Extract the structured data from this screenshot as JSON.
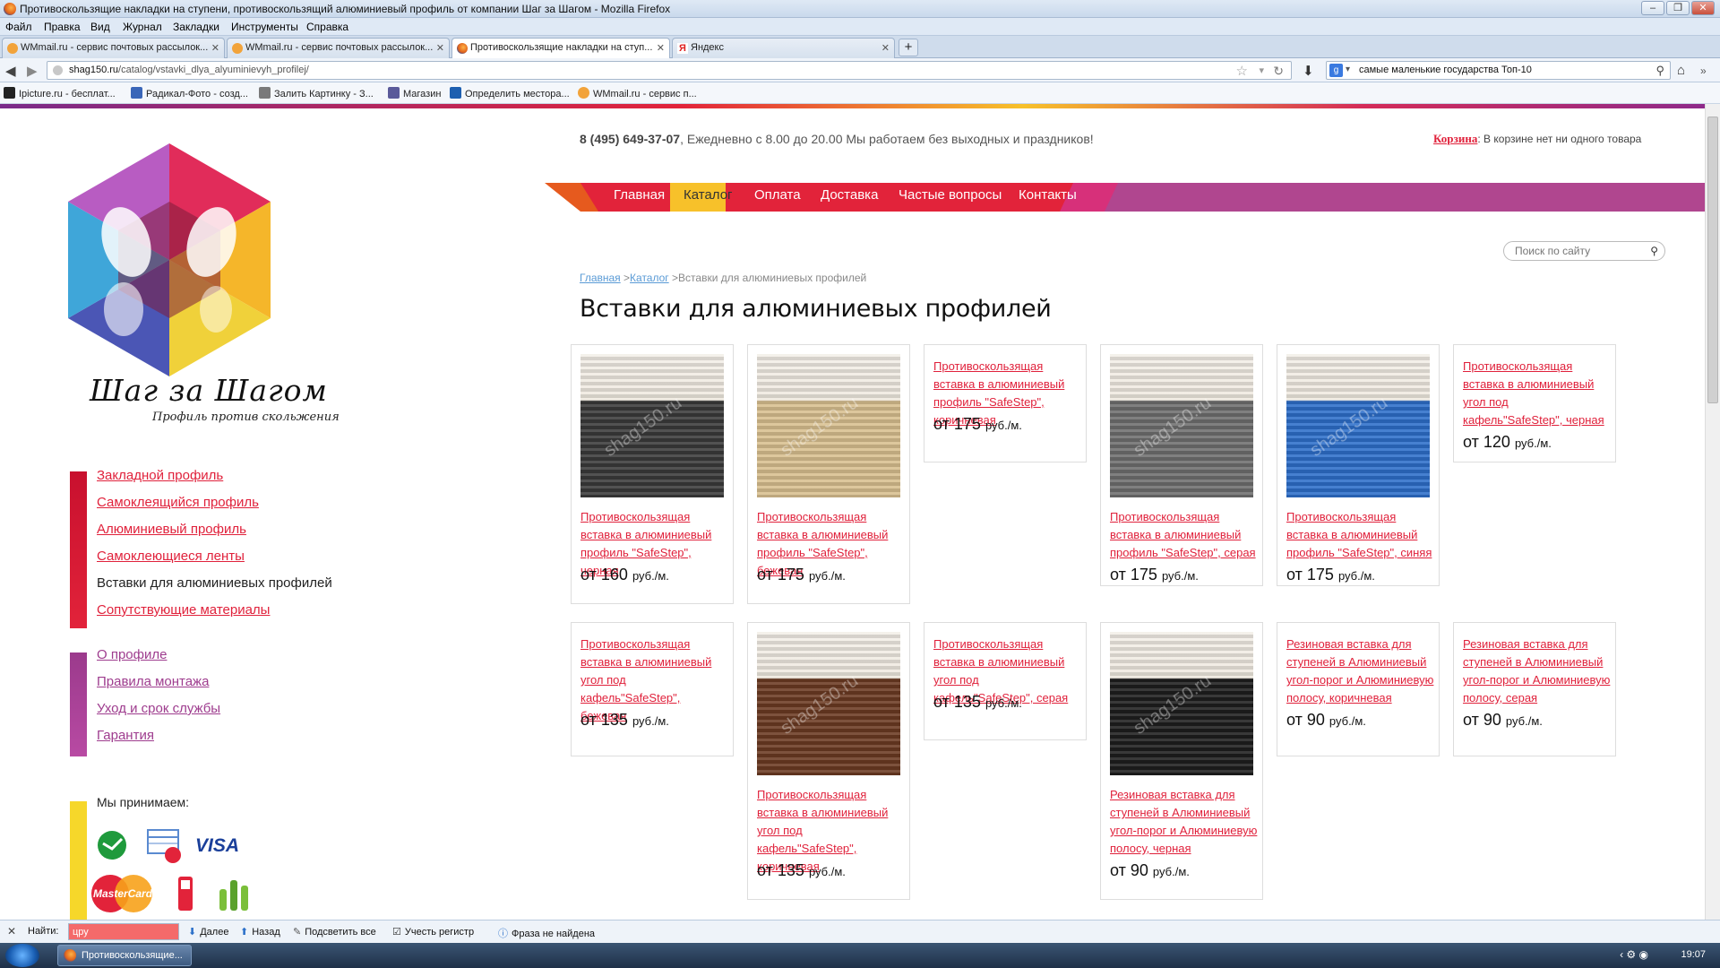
{
  "window": {
    "title": "Противоскользящие накладки на ступени, противоскользящий алюминиевый профиль от компании Шаг за Шагом - Mozilla Firefox"
  },
  "menu": [
    "Файл",
    "Правка",
    "Вид",
    "Журнал",
    "Закладки",
    "Инструменты",
    "Справка"
  ],
  "tabs": [
    {
      "label": "WMmail.ru - сервис почтовых рассылок...",
      "icon": "wmmail-icon"
    },
    {
      "label": "WMmail.ru - сервис почтовых рассылок...",
      "icon": "wmmail-icon"
    },
    {
      "label": "Противоскользящие накладки на ступ...",
      "icon": "firefox-icon"
    },
    {
      "label": "Яндекс",
      "icon": "yandex-icon"
    }
  ],
  "address": {
    "domain": "shag150.ru",
    "path": "/catalog/vstavki_dlya_alyuminievyh_profilej/"
  },
  "search_engine": {
    "query": "самые маленькие государства Топ-10"
  },
  "bookmarks": [
    "Ipicture.ru - бесплат...",
    "Радикал-Фото - созд...",
    "Залить Картинку - З...",
    "Магазин",
    "Определить местора...",
    "WMmail.ru - сервис п..."
  ],
  "site": {
    "logo_text": "Шаг за Шагом",
    "logo_sub": "Профиль против скольжения",
    "phone": "8 (495) 649-37-07",
    "hours": ", Ежедневно с 8.00 до 20.00 Мы работаем без выходных и праздников!",
    "cart_link": "Корзина",
    "cart_text": ": В корзине нет ни одного товара",
    "nav": [
      "Главная",
      "Каталог",
      "Оплата",
      "Доставка",
      "Частые вопросы",
      "Контакты"
    ],
    "search_placeholder": "Поиск по сайту",
    "breadcrumb": {
      "home": "Главная",
      "catalog": "Каталог",
      "current": "Вставки для алюминиевых профилей"
    },
    "page_title": "Вставки для алюминиевых профилей",
    "catalog_menu": [
      "Закладной профиль",
      "Самоклеящийся профиль",
      "Алюминиевый профиль",
      "Самоклеющиеся ленты",
      "Вставки для алюминиевых профилей",
      "Сопутствующие материалы"
    ],
    "info_menu": [
      "О профиле",
      "Правила монтажа",
      "Уход и срок службы",
      "Гарантия"
    ],
    "payments_title": "Мы принимаем:",
    "payment_labels": [
      "VISA",
      "MasterCard"
    ]
  },
  "price_prefix": "от",
  "currency": "руб./м.",
  "products": [
    {
      "name": "Противоскользящая вставка в алюминиевый профиль \"SafeStep\", черная",
      "price": "160",
      "color": "#3a3a3a"
    },
    {
      "name": "Противоскользящая вставка в алюминиевый профиль \"SafeStep\", бежевая",
      "price": "175",
      "color": "#d8bf8f"
    },
    {
      "name": "Противоскользящая вставка в алюминиевый профиль \"SafeStep\", коричневая",
      "price": "175",
      "color": null
    },
    {
      "name": "Противоскользящая вставка в алюминиевый профиль \"SafeStep\", серая",
      "price": "175",
      "color": "#6e6e6e"
    },
    {
      "name": "Противоскользящая вставка в алюминиевый профиль \"SafeStep\", синяя",
      "price": "175",
      "color": "#2d6ec9"
    },
    {
      "name": "Противоскользящая вставка в алюминиевый угол под кафель\"SafeStep\", черная",
      "price": "120",
      "color": null
    },
    {
      "name": "Противоскользящая вставка в алюминиевый угол под кафель\"SafeStep\", бежевая",
      "price": "135",
      "color": null
    },
    {
      "name": "Противоскользящая вставка в алюминиевый угол под кафель\"SafeStep\", коричневая",
      "price": "135",
      "color": "#6b3a22"
    },
    {
      "name": "Противоскользящая вставка в алюминиевый угол под кафель\"SafeStep\", серая",
      "price": "135",
      "color": null
    },
    {
      "name": "Резиновая вставка для ступеней в Алюминиевый угол-порог и Алюминиевую полосу, черная",
      "price": "90",
      "color": "#1e1e1e"
    },
    {
      "name": "Резиновая вставка для ступеней в Алюминиевый угол-порог и Алюминиевую полосу, коричневая",
      "price": "90",
      "color": null
    },
    {
      "name": "Резиновая вставка для ступеней в Алюминиевый угол-порог и Алюминиевую полосу, серая",
      "price": "90",
      "color": null
    }
  ],
  "findbar": {
    "label": "Найти:",
    "value": "цру",
    "next": "Далее",
    "prev": "Назад",
    "highlight": "Подсветить все",
    "match_case": "Учесть регистр",
    "status": "Фраза не найдена"
  },
  "taskbar": {
    "item": "Противоскользящие...",
    "time": "19:07"
  }
}
